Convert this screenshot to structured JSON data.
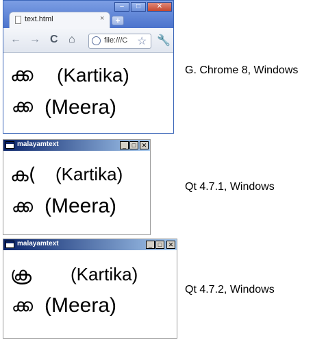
{
  "chrome": {
    "tab_title": "text.html",
    "tab_close": "×",
    "new_tab": "+",
    "address": "file:///C",
    "btn_min": "–",
    "btn_max": "□",
    "btn_close": "✕",
    "icons": {
      "back": "←",
      "forward": "→",
      "reload": "C",
      "home": "⌂",
      "star": "☆",
      "wrench": "🔧"
    }
  },
  "lines": {
    "kartika_glyph_chrome": "ക്ക",
    "kartika_label": "(Kartika)",
    "meera_glyph": "ക്ക",
    "meera_label": "(Meera)",
    "kartika_glyph_qt471": "ക(",
    "kartika_glyph_qt472": "ക്ര"
  },
  "qt1": {
    "title": "malayamtext",
    "min": "_",
    "max": "□",
    "close": "✕"
  },
  "qt2": {
    "title": "malayamtext",
    "min": "_",
    "max": "□",
    "close": "✕"
  },
  "captions": {
    "chrome": "G. Chrome 8, Windows",
    "qt471": "Qt 4.7.1, Windows",
    "qt472": "Qt 4.7.2, Windows"
  }
}
